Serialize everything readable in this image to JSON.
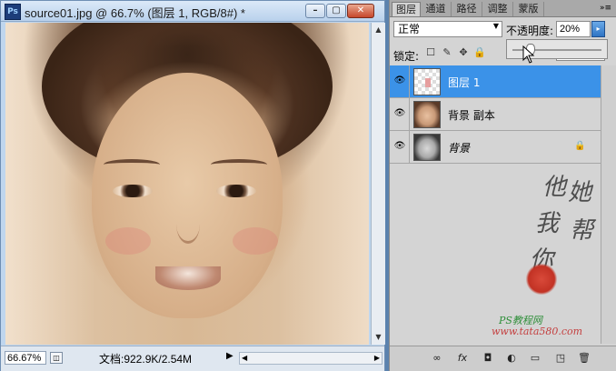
{
  "document_window": {
    "app_icon": "Ps",
    "title": "source01.jpg @ 66.7% (图层 1, RGB/8#) *",
    "buttons": {
      "minimize": "–",
      "restore": "▢",
      "close": "✕"
    },
    "status": {
      "zoom": "66.67%",
      "doc_info": "文档:922.9K/2.54M",
      "arrow": "▶",
      "doc_icon": "◫"
    },
    "scroll": {
      "up": "▲",
      "down": "▼",
      "left": "◀",
      "right": "▶"
    }
  },
  "layers_panel": {
    "tabs": [
      "图层",
      "通道",
      "路径",
      "调整",
      "蒙版"
    ],
    "menu_icon": "»≡",
    "blend_mode": "正常",
    "dropdown_arrow": "▼",
    "opacity_label": "不透明度:",
    "opacity_value": "20%",
    "opacity_slider_level": 0.2,
    "opacity_button": "▸",
    "lock_label": "锁定:",
    "lock_icons": [
      "☐",
      "✎",
      "✥",
      "🔒"
    ],
    "layers": [
      {
        "name": "图层 1",
        "visible": true,
        "selected": true,
        "thumb": "transparent-checker"
      },
      {
        "name": "背景 副本",
        "visible": true,
        "selected": false,
        "thumb": "sepia-face"
      },
      {
        "name": "背景",
        "visible": true,
        "selected": false,
        "thumb": "gray-face",
        "locked": true
      }
    ],
    "eye_glyph": "👁",
    "lock_glyph": "🔒",
    "watermark": {
      "chars": [
        "他",
        "她",
        "我",
        "帮",
        "你"
      ],
      "site_name": "PS教程网",
      "url": "www.tata580.com"
    },
    "bottom_icons": [
      "∞",
      "fx",
      "◘",
      "◐",
      "▭",
      "◳",
      "🗑"
    ]
  }
}
